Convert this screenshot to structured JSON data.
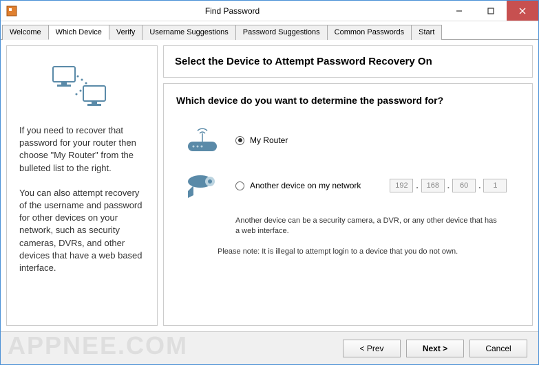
{
  "window": {
    "title": "Find Password"
  },
  "tabs": [
    {
      "label": "Welcome"
    },
    {
      "label": "Which Device"
    },
    {
      "label": "Verify"
    },
    {
      "label": "Username Suggestions"
    },
    {
      "label": "Password Suggestions"
    },
    {
      "label": "Common Passwords"
    },
    {
      "label": "Start"
    }
  ],
  "sidebar": {
    "para1": "If you need to recover that password for your router then choose \"My Router\" from the bulleted list to the right.",
    "para2": "You can also attempt recovery of the username and password for other devices on your network, such as security cameras, DVRs, and other devices that have a web based interface."
  },
  "main": {
    "heading": "Select the Device to Attempt Password Recovery On",
    "question": "Which device do you want to determine the password for?",
    "option1": "My Router",
    "option2": "Another device on my network",
    "ip": {
      "a": "192",
      "b": "168",
      "c": "60",
      "d": "1"
    },
    "note1": "Another device can be a security camera, a DVR, or any other device that has a web interface.",
    "note2": "Please note: It is illegal to attempt login to a device that you do not own."
  },
  "footer": {
    "prev": "< Prev",
    "next": "Next >",
    "cancel": "Cancel"
  },
  "watermark": "APPNEE.COM"
}
